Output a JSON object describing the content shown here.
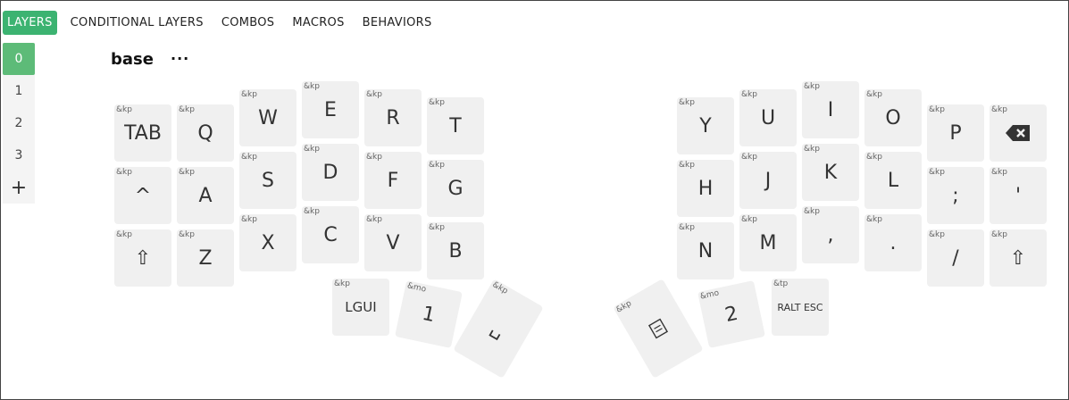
{
  "nav": {
    "items": [
      "LAYERS",
      "CONDITIONAL LAYERS",
      "COMBOS",
      "MACROS",
      "BEHAVIORS"
    ],
    "active": "LAYERS",
    "accent": "#3cb371"
  },
  "layers": {
    "items": [
      "0",
      "1",
      "2",
      "3"
    ],
    "active": "0",
    "add_label": "+"
  },
  "layer": {
    "name": "base",
    "menu": "···"
  },
  "keys": [
    {
      "b": "&kp",
      "l": "TAB"
    },
    {
      "b": "&kp",
      "l": "Q"
    },
    {
      "b": "&kp",
      "l": "W"
    },
    {
      "b": "&kp",
      "l": "E"
    },
    {
      "b": "&kp",
      "l": "R"
    },
    {
      "b": "&kp",
      "l": "T"
    },
    {
      "b": "&kp",
      "l": "Y"
    },
    {
      "b": "&kp",
      "l": "U"
    },
    {
      "b": "&kp",
      "l": "I"
    },
    {
      "b": "&kp",
      "l": "O"
    },
    {
      "b": "&kp",
      "l": "P"
    },
    {
      "b": "&kp",
      "l": "",
      "icon": "backspace-icon"
    },
    {
      "b": "&kp",
      "l": "^"
    },
    {
      "b": "&kp",
      "l": "A"
    },
    {
      "b": "&kp",
      "l": "S"
    },
    {
      "b": "&kp",
      "l": "D"
    },
    {
      "b": "&kp",
      "l": "F"
    },
    {
      "b": "&kp",
      "l": "G"
    },
    {
      "b": "&kp",
      "l": "H"
    },
    {
      "b": "&kp",
      "l": "J"
    },
    {
      "b": "&kp",
      "l": "K"
    },
    {
      "b": "&kp",
      "l": "L"
    },
    {
      "b": "&kp",
      "l": ";"
    },
    {
      "b": "&kp",
      "l": "'"
    },
    {
      "b": "&kp",
      "l": "⇧"
    },
    {
      "b": "&kp",
      "l": "Z"
    },
    {
      "b": "&kp",
      "l": "X"
    },
    {
      "b": "&kp",
      "l": "C"
    },
    {
      "b": "&kp",
      "l": "V"
    },
    {
      "b": "&kp",
      "l": "B"
    },
    {
      "b": "&kp",
      "l": "N"
    },
    {
      "b": "&kp",
      "l": "M"
    },
    {
      "b": "&kp",
      "l": ","
    },
    {
      "b": "&kp",
      "l": "."
    },
    {
      "b": "&kp",
      "l": "/"
    },
    {
      "b": "&kp",
      "l": "⇧"
    },
    {
      "b": "&kp",
      "l": "LGUI"
    },
    {
      "b": "&mo",
      "l": "1"
    },
    {
      "b": "&kp",
      "l": "␣",
      "icon": "space-icon"
    },
    {
      "b": "&kp",
      "l": "",
      "icon": "enter-icon"
    },
    {
      "b": "&mo",
      "l": "2"
    },
    {
      "b": "&tp",
      "l": "RALT ESC"
    }
  ]
}
